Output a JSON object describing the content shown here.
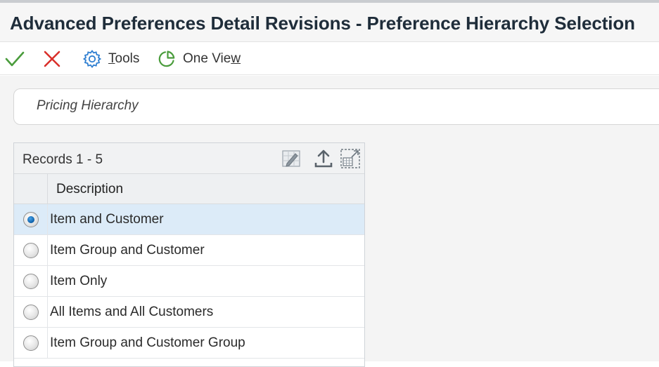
{
  "window": {
    "title": "Advanced Preferences Detail Revisions - Preference Hierarchy Selection"
  },
  "toolbar": {
    "ok_icon": "checkmark-icon",
    "cancel_icon": "close-x-icon",
    "tools_label": "Tools",
    "tools_mnemonic": "T",
    "tools_rest": "ools",
    "one_view_label": "One View",
    "one_view_prefix": "One Vie",
    "one_view_mnemonic": "w"
  },
  "hierarchy": {
    "label": "Pricing Hierarchy"
  },
  "grid": {
    "records_label": "Records 1 - 5",
    "columns": [
      "Description"
    ],
    "rows": [
      {
        "description": "Item and Customer",
        "selected": true
      },
      {
        "description": "Item Group and Customer",
        "selected": false
      },
      {
        "description": "Item Only",
        "selected": false
      },
      {
        "description": "All Items and All Customers",
        "selected": false
      },
      {
        "description": "Item Group and Customer Group",
        "selected": false
      }
    ]
  },
  "colors": {
    "accent_blue": "#2f7fd1",
    "ok_green": "#4a9c3c",
    "cancel_red": "#d9302b",
    "selected_row": "#dcebf8"
  }
}
